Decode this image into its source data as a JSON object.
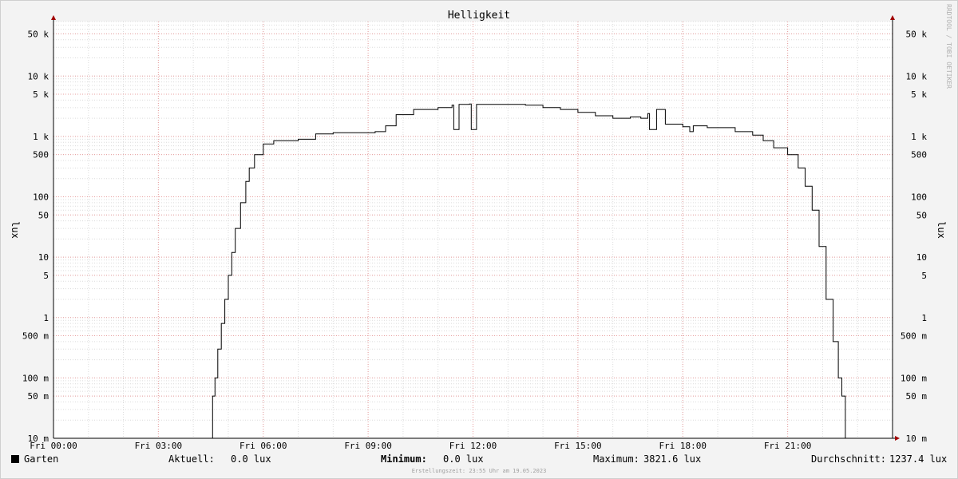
{
  "chart_data": {
    "type": "line",
    "title": "Helligkeit",
    "ylabel": "lux",
    "watermark": "RRDTOOL / TOBI OETIKER",
    "scale": "log",
    "ylim": [
      0.01,
      80000
    ],
    "xlim": [
      0,
      24
    ],
    "grid": true,
    "y_ticks": [
      {
        "value": 50000,
        "label": "50 k"
      },
      {
        "value": 10000,
        "label": "10 k"
      },
      {
        "value": 5000,
        "label": "5 k"
      },
      {
        "value": 1000,
        "label": "1 k"
      },
      {
        "value": 500,
        "label": "500"
      },
      {
        "value": 100,
        "label": "100"
      },
      {
        "value": 50,
        "label": "50"
      },
      {
        "value": 10,
        "label": "10"
      },
      {
        "value": 5,
        "label": "5"
      },
      {
        "value": 1,
        "label": "1"
      },
      {
        "value": 0.5,
        "label": "500 m"
      },
      {
        "value": 0.1,
        "label": "100 m"
      },
      {
        "value": 0.05,
        "label": "50 m"
      },
      {
        "value": 0.01,
        "label": "10 m"
      }
    ],
    "x_ticks": [
      {
        "value": 0,
        "label": "Fri 00:00"
      },
      {
        "value": 3,
        "label": "Fri 03:00"
      },
      {
        "value": 6,
        "label": "Fri 06:00"
      },
      {
        "value": 9,
        "label": "Fri 09:00"
      },
      {
        "value": 12,
        "label": "Fri 12:00"
      },
      {
        "value": 15,
        "label": "Fri 15:00"
      },
      {
        "value": 18,
        "label": "Fri 18:00"
      },
      {
        "value": 21,
        "label": "Fri 21:00"
      }
    ],
    "series": [
      {
        "name": "Garten",
        "color": "#000000",
        "points": [
          [
            0,
            0.01
          ],
          [
            4.5,
            0.01
          ],
          [
            4.55,
            0.05
          ],
          [
            4.62,
            0.1
          ],
          [
            4.7,
            0.3
          ],
          [
            4.8,
            0.8
          ],
          [
            4.9,
            2
          ],
          [
            5.0,
            5
          ],
          [
            5.1,
            12
          ],
          [
            5.2,
            30
          ],
          [
            5.35,
            80
          ],
          [
            5.5,
            180
          ],
          [
            5.6,
            300
          ],
          [
            5.75,
            500
          ],
          [
            6.0,
            750
          ],
          [
            6.3,
            850
          ],
          [
            7.0,
            900
          ],
          [
            7.5,
            1100
          ],
          [
            8.0,
            1150
          ],
          [
            9.2,
            1200
          ],
          [
            9.5,
            1500
          ],
          [
            9.8,
            2300
          ],
          [
            10.3,
            2800
          ],
          [
            11.0,
            3000
          ],
          [
            11.4,
            3300
          ],
          [
            11.45,
            1300
          ],
          [
            11.55,
            1300
          ],
          [
            11.6,
            3400
          ],
          [
            11.9,
            3450
          ],
          [
            11.95,
            1300
          ],
          [
            12.05,
            1300
          ],
          [
            12.1,
            3400
          ],
          [
            13.0,
            3400
          ],
          [
            13.5,
            3300
          ],
          [
            14.0,
            3000
          ],
          [
            14.5,
            2800
          ],
          [
            15.0,
            2500
          ],
          [
            15.5,
            2200
          ],
          [
            16.0,
            2000
          ],
          [
            16.5,
            2100
          ],
          [
            16.8,
            2000
          ],
          [
            17.0,
            2400
          ],
          [
            17.05,
            1300
          ],
          [
            17.15,
            1300
          ],
          [
            17.25,
            2800
          ],
          [
            17.5,
            1600
          ],
          [
            18.0,
            1450
          ],
          [
            18.2,
            1200
          ],
          [
            18.3,
            1500
          ],
          [
            18.7,
            1400
          ],
          [
            19.5,
            1200
          ],
          [
            20.0,
            1050
          ],
          [
            20.3,
            850
          ],
          [
            20.6,
            650
          ],
          [
            21.0,
            500
          ],
          [
            21.3,
            300
          ],
          [
            21.5,
            150
          ],
          [
            21.7,
            60
          ],
          [
            21.9,
            15
          ],
          [
            22.1,
            2
          ],
          [
            22.3,
            0.4
          ],
          [
            22.45,
            0.1
          ],
          [
            22.55,
            0.05
          ],
          [
            22.62,
            0.05
          ],
          [
            22.65,
            0.01
          ],
          [
            24,
            0.01
          ]
        ]
      }
    ],
    "summary": {
      "legend_name": "Garten",
      "current_label": "Aktuell:",
      "current_value": "0.0 lux",
      "minimum_label": "Minimum:",
      "minimum_value": "0.0 lux",
      "maximum_label": "Maximum:",
      "maximum_value": "3821.6 lux",
      "average_label": "Durchschnitt:",
      "average_value": "1237.4 lux"
    },
    "footer": "Erstellungszeit: 23:55 Uhr am 19.05.2023"
  }
}
